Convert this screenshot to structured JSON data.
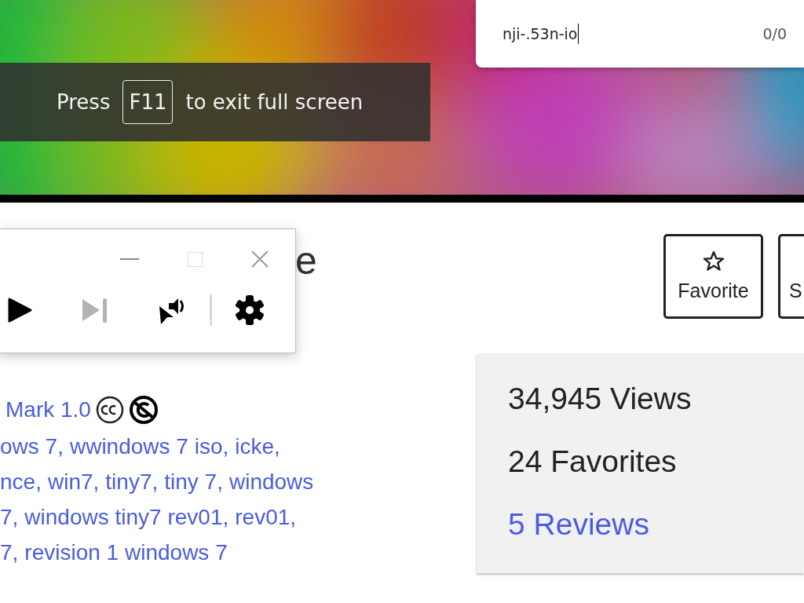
{
  "fullscreen_notice": {
    "before": "Press",
    "key": "F11",
    "after": "to exit full screen"
  },
  "find_bar": {
    "value": "nji-.53n-io",
    "count": "0/0"
  },
  "page_title": "e",
  "mini_player": {
    "controls": [
      {
        "kind": "play",
        "disabled": false
      },
      {
        "kind": "next",
        "disabled": true
      },
      {
        "kind": "cast",
        "disabled": false
      },
      {
        "kind": "divider"
      },
      {
        "kind": "settings",
        "disabled": false
      }
    ]
  },
  "action_buttons": [
    {
      "label": "Favorite",
      "kind": "star"
    },
    {
      "label": "S",
      "kind": "cut"
    }
  ],
  "license": {
    "text": "Mark 1.0"
  },
  "tag_lines": [
    [
      "ows 7,",
      "wwindows 7 iso,",
      "icke,"
    ],
    [
      "nce,",
      "win7,",
      "tiny7,",
      "tiny 7,",
      "windows"
    ],
    [
      "7,",
      "windows tiny7 rev01,",
      "rev01,"
    ],
    [
      "7,",
      "revision 1 windows 7"
    ]
  ],
  "stats": [
    {
      "text": "34,945 Views",
      "link": false
    },
    {
      "text": "24 Favorites",
      "link": false
    },
    {
      "text": "5 Reviews",
      "link": true
    }
  ]
}
